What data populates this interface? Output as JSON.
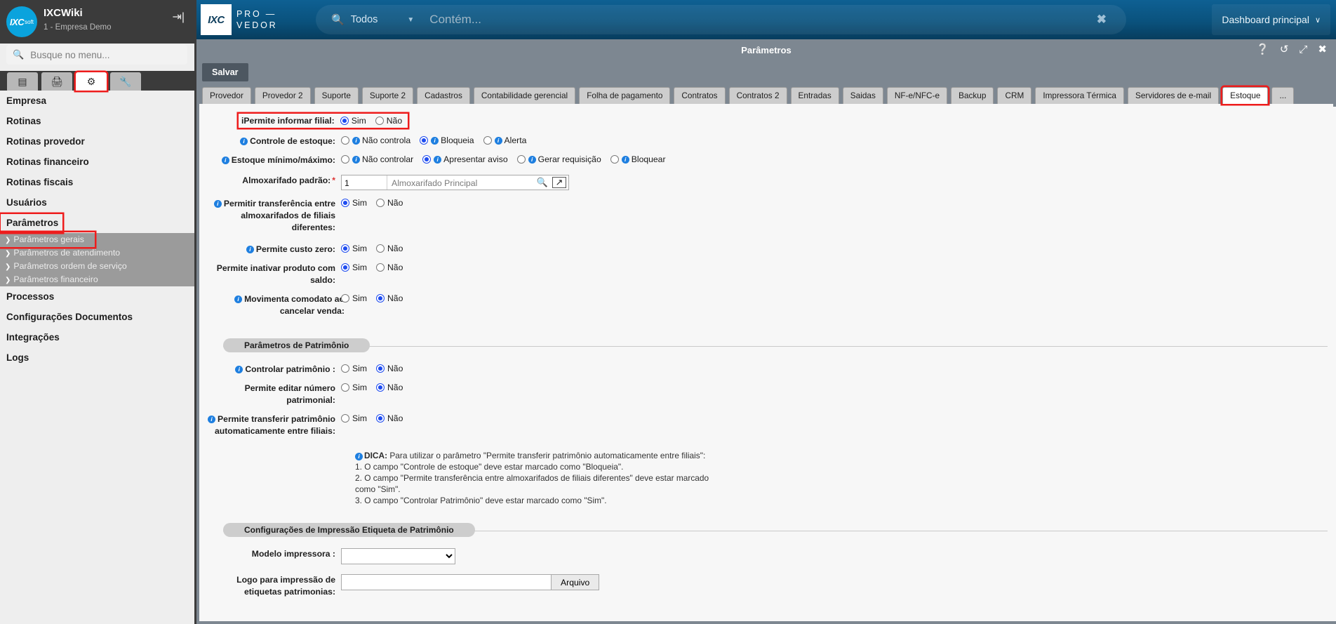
{
  "sidebar": {
    "logo_main": "IXC",
    "logo_sub": "soft",
    "title": "IXCWiki",
    "subtitle": "1 - Empresa Demo",
    "exit_icon": "logout-icon",
    "search_placeholder": "Busque no menu...",
    "search_icon": "search-icon",
    "tabs": [
      {
        "name": "list-tab",
        "glyph": "▤",
        "active": false
      },
      {
        "name": "print-tab",
        "glyph": "⎙",
        "active": false
      },
      {
        "name": "gears-tab",
        "glyph": "⚙",
        "active": true
      },
      {
        "name": "wrench-tab",
        "glyph": "🔧",
        "active": false
      }
    ],
    "items": [
      {
        "label": "Empresa",
        "highlighted": false
      },
      {
        "label": "Rotinas",
        "highlighted": false
      },
      {
        "label": "Rotinas provedor",
        "highlighted": false
      },
      {
        "label": "Rotinas financeiro",
        "highlighted": false
      },
      {
        "label": "Rotinas fiscais",
        "highlighted": false
      },
      {
        "label": "Usuários",
        "highlighted": false
      },
      {
        "label": "Parâmetros",
        "highlighted": true
      }
    ],
    "subitems": [
      {
        "label": "Parâmetros gerais",
        "highlighted": true
      },
      {
        "label": "Parâmetros de atendimento",
        "highlighted": false
      },
      {
        "label": "Parâmetros ordem de serviço",
        "highlighted": false
      },
      {
        "label": "Parâmetros financeiro",
        "highlighted": false
      }
    ],
    "items_after": [
      {
        "label": "Processos"
      },
      {
        "label": "Configurações Documentos"
      },
      {
        "label": "Integrações"
      },
      {
        "label": "Logs"
      }
    ]
  },
  "topbar": {
    "logo_text": "IXC",
    "brand_line1": "PRO —",
    "brand_line2": "VEDOR",
    "search_icon": "search-icon",
    "search_scope": "Todos",
    "scope_caret": "▼",
    "search_placeholder": "Contém...",
    "clear_icon": "✖",
    "dashboard_label": "Dashboard principal",
    "dashboard_caret": "∨"
  },
  "window": {
    "title": "Parâmetros",
    "controls": [
      {
        "name": "help-icon",
        "glyph": "?"
      },
      {
        "name": "history-icon",
        "glyph": "↺"
      },
      {
        "name": "expand-icon",
        "glyph": "⤢"
      },
      {
        "name": "close-icon",
        "glyph": "✖"
      }
    ],
    "save_label": "Salvar",
    "tabs": [
      {
        "label": "Provedor",
        "active": false
      },
      {
        "label": "Provedor 2",
        "active": false
      },
      {
        "label": "Suporte",
        "active": false
      },
      {
        "label": "Suporte 2",
        "active": false
      },
      {
        "label": "Cadastros",
        "active": false
      },
      {
        "label": "Contabilidade gerencial",
        "active": false
      },
      {
        "label": "Folha de pagamento",
        "active": false
      },
      {
        "label": "Contratos",
        "active": false
      },
      {
        "label": "Contratos 2",
        "active": false
      },
      {
        "label": "Entradas",
        "active": false
      },
      {
        "label": "Saidas",
        "active": false
      },
      {
        "label": "NF-e/NFC-e",
        "active": false
      },
      {
        "label": "Backup",
        "active": false
      },
      {
        "label": "CRM",
        "active": false
      },
      {
        "label": "Impressora Térmica",
        "active": false
      },
      {
        "label": "Servidores de e-mail",
        "active": false
      },
      {
        "label": "Estoque",
        "active": true
      },
      {
        "label": "...",
        "active": false
      }
    ]
  },
  "form": {
    "rows": [
      {
        "label": "Permite informar filial:",
        "has_info": true,
        "required": false,
        "highlighted": true,
        "options": [
          {
            "label": "Sim",
            "checked": true,
            "info": false
          },
          {
            "label": "Não",
            "checked": false,
            "info": false
          }
        ]
      },
      {
        "label": "Controle de estoque:",
        "has_info": true,
        "required": false,
        "highlighted": false,
        "options": [
          {
            "label": "Não controla",
            "checked": false,
            "info": true
          },
          {
            "label": "Bloqueia",
            "checked": true,
            "info": true
          },
          {
            "label": "Alerta",
            "checked": false,
            "info": true
          }
        ]
      },
      {
        "label": "Estoque mínimo/máximo:",
        "has_info": true,
        "required": false,
        "highlighted": false,
        "options": [
          {
            "label": "Não controlar",
            "checked": false,
            "info": true
          },
          {
            "label": "Apresentar aviso",
            "checked": true,
            "info": true
          },
          {
            "label": "Gerar requisição",
            "checked": false,
            "info": true
          },
          {
            "label": "Bloquear",
            "checked": false,
            "info": true
          }
        ]
      },
      {
        "label": "Permitir transferência entre almoxarifados de filiais diferentes:",
        "has_info": true,
        "required": false,
        "highlighted": false,
        "options": [
          {
            "label": "Sim",
            "checked": true,
            "info": false
          },
          {
            "label": "Não",
            "checked": false,
            "info": false
          }
        ]
      },
      {
        "label": "Permite custo zero:",
        "has_info": true,
        "required": false,
        "highlighted": false,
        "options": [
          {
            "label": "Sim",
            "checked": true,
            "info": false
          },
          {
            "label": "Não",
            "checked": false,
            "info": false
          }
        ]
      },
      {
        "label": "Permite inativar produto com saldo:",
        "has_info": false,
        "required": false,
        "highlighted": false,
        "options": [
          {
            "label": "Sim",
            "checked": true,
            "info": false
          },
          {
            "label": "Não",
            "checked": false,
            "info": false
          }
        ]
      },
      {
        "label": "Movimenta comodato ao cancelar venda:",
        "has_info": true,
        "required": false,
        "highlighted": false,
        "options": [
          {
            "label": "Sim",
            "checked": false,
            "info": false
          },
          {
            "label": "Não",
            "checked": true,
            "info": false
          }
        ]
      }
    ],
    "almoxarifado": {
      "label": "Almoxarifado padrão:",
      "required_mark": "*",
      "id_value": "1",
      "name_value": "Almoxarifado Principal",
      "search_icon": "🔍",
      "open_icon": "↗"
    },
    "patrimonio_legend": "Parâmetros de Patrimônio",
    "patrimonio_rows": [
      {
        "label": "Controlar patrimônio :",
        "has_info": true,
        "options": [
          {
            "label": "Sim",
            "checked": false
          },
          {
            "label": "Não",
            "checked": true
          }
        ]
      },
      {
        "label": "Permite editar número patrimonial:",
        "has_info": false,
        "options": [
          {
            "label": "Sim",
            "checked": false
          },
          {
            "label": "Não",
            "checked": true
          }
        ]
      },
      {
        "label": "Permite transferir patrimônio automaticamente entre filiais:",
        "has_info": true,
        "options": [
          {
            "label": "Sim",
            "checked": false
          },
          {
            "label": "Não",
            "checked": true
          }
        ]
      }
    ],
    "hint": {
      "title": "DICA:",
      "intro": "Para utilizar o parâmetro \"Permite transferir patrimônio automaticamente entre filiais\":",
      "lines": [
        "1. O campo \"Controle de estoque\" deve estar marcado como \"Bloqueia\".",
        "2. O campo \"Permite transferência entre almoxarifados de filiais diferentes\" deve estar marcado como \"Sim\".",
        "3. O campo \"Controlar Patrimônio\" deve estar marcado como \"Sim\"."
      ]
    },
    "print_legend": "Configurações de Impressão Etiqueta de Patrimônio",
    "printer_model": {
      "label": "Modelo impressora :",
      "selected": "",
      "options": [
        ""
      ]
    },
    "logo_field": {
      "label": "Logo para impressão de etiquetas patrimonias:",
      "value": "",
      "button_label": "Arquivo"
    }
  },
  "colors": {
    "brand_blue": "#0a527d",
    "highlight_red": "#ee1c1c",
    "radio_blue": "#1f4cf0",
    "info_blue": "#1e7fe0",
    "window_gray": "#7d8791"
  }
}
